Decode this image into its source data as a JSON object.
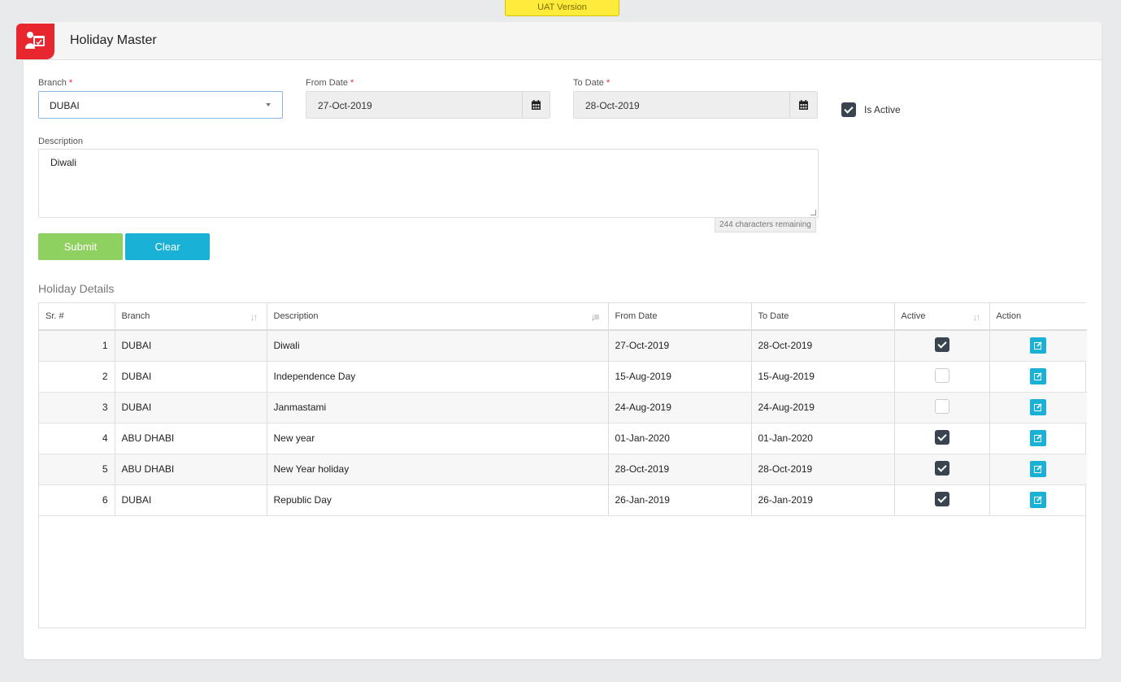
{
  "env_badge": "UAT Version",
  "header": {
    "title": "Holiday Master",
    "icon": "user-calendar-icon",
    "accent": "#e8262e"
  },
  "form": {
    "branch_label": "Branch",
    "branch_value": "DUBAI",
    "from_date_label": "From Date",
    "from_date_value": "27-Oct-2019",
    "to_date_label": "To Date",
    "to_date_value": "28-Oct-2019",
    "required_mark": "*",
    "is_active_label": "Is Active",
    "is_active_checked": true,
    "description_label": "Description",
    "description_value": "Diwali",
    "chars_remaining": "244 characters remaining",
    "submit_label": "Submit",
    "clear_label": "Clear"
  },
  "grid": {
    "title": "Holiday Details",
    "columns": [
      "Sr. #",
      "Branch",
      "Description",
      "From Date",
      "To Date",
      "Active",
      "Action"
    ],
    "rows": [
      {
        "sr": "1",
        "branch": "DUBAI",
        "description": "Diwali",
        "from": "27-Oct-2019",
        "to": "28-Oct-2019",
        "active": true
      },
      {
        "sr": "2",
        "branch": "DUBAI",
        "description": "Independence Day",
        "from": "15-Aug-2019",
        "to": "15-Aug-2019",
        "active": false
      },
      {
        "sr": "3",
        "branch": "DUBAI",
        "description": "Janmastami",
        "from": "24-Aug-2019",
        "to": "24-Aug-2019",
        "active": false
      },
      {
        "sr": "4",
        "branch": "ABU DHABI",
        "description": "New year",
        "from": "01-Jan-2020",
        "to": "01-Jan-2020",
        "active": true
      },
      {
        "sr": "5",
        "branch": "ABU DHABI",
        "description": "New Year holiday",
        "from": "28-Oct-2019",
        "to": "28-Oct-2019",
        "active": true
      },
      {
        "sr": "6",
        "branch": "DUBAI",
        "description": "Republic Day",
        "from": "26-Jan-2019",
        "to": "26-Jan-2019",
        "active": true
      }
    ]
  },
  "colors": {
    "submit": "#8fd160",
    "clear": "#19b1d6",
    "checkbox": "#3a4450",
    "badge": "#ffeb3b"
  }
}
